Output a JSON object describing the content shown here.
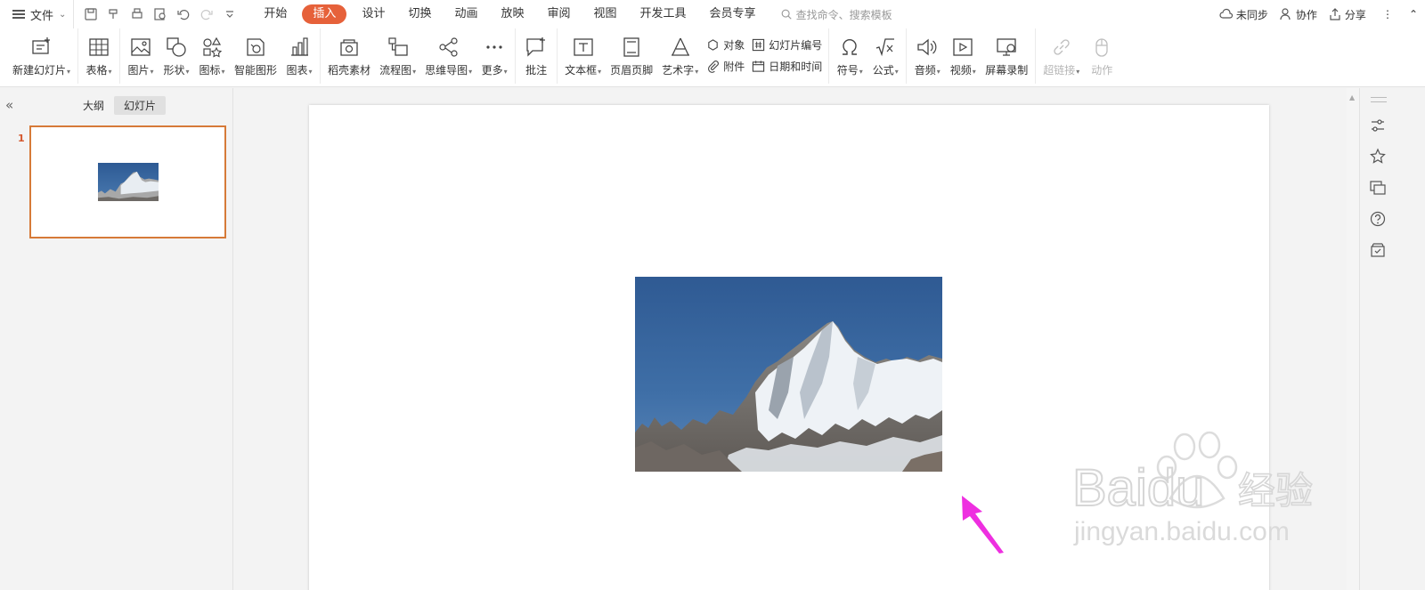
{
  "menu": {
    "file_label": "文件"
  },
  "tabs": [
    {
      "label": "开始"
    },
    {
      "label": "插入"
    },
    {
      "label": "设计"
    },
    {
      "label": "切换"
    },
    {
      "label": "动画"
    },
    {
      "label": "放映"
    },
    {
      "label": "审阅"
    },
    {
      "label": "视图"
    },
    {
      "label": "开发工具"
    },
    {
      "label": "会员专享"
    }
  ],
  "active_tab": "插入",
  "search": {
    "placeholder": "查找命令、搜索模板"
  },
  "right_actions": {
    "sync": "未同步",
    "collab": "协作",
    "share": "分享"
  },
  "ribbon": {
    "new_slide": "新建幻灯片",
    "table": "表格",
    "picture": "图片",
    "shape": "形状",
    "icon": "图标",
    "smart_art": "智能图形",
    "chart": "图表",
    "material": "稻壳素材",
    "flowchart": "流程图",
    "mindmap": "思维导图",
    "more": "更多",
    "comment": "批注",
    "textbox": "文本框",
    "header_footer": "页眉页脚",
    "wordart": "艺术字",
    "object": "对象",
    "attachment": "附件",
    "slide_number": "幻灯片编号",
    "date_time": "日期和时间",
    "symbol": "符号",
    "formula": "公式",
    "audio": "音频",
    "video": "视频",
    "screen_record": "屏幕录制",
    "hyperlink": "超链接",
    "action": "动作"
  },
  "left_panel": {
    "tab_outline": "大纲",
    "tab_slides": "幻灯片",
    "slide_number": "1"
  },
  "colors": {
    "accent": "#e6613a",
    "thumb_border": "#d67a38",
    "arrow": "#ee2fe0"
  },
  "watermark": {
    "brand": "Baidu",
    "brand_cn": "经验",
    "url": "jingyan.baidu.com"
  }
}
